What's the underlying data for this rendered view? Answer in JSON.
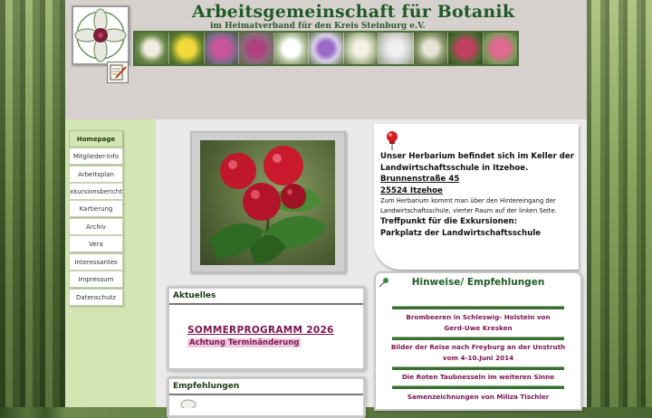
{
  "header": {
    "title": "Arbeitsgemeinschaft für Botanik",
    "subtitle": "im Heimatverband für den Kreis Steinburg e.V."
  },
  "icons": {
    "logo": "flower-emblem-icon",
    "edit": "notepad-pen-icon",
    "pin": "red-pushpin-icon",
    "pushpin": "green-pushpin-icon"
  },
  "colors": {
    "title_green": "#1f5a28",
    "link_maroon": "#7a1450",
    "sidebar_green": "#d4e5b4"
  },
  "nav": {
    "items": [
      {
        "label": "Homepage",
        "active": true
      },
      {
        "label": "Mitglieder-Info"
      },
      {
        "label": "Arbeitsplan"
      },
      {
        "label": "Exkursionsberichte"
      },
      {
        "label": "Kartierung"
      },
      {
        "label": "Archiv"
      },
      {
        "label": "Vera"
      },
      {
        "label": "Interessantes"
      },
      {
        "label": "Impressum"
      },
      {
        "label": "Datenschutz"
      }
    ]
  },
  "info": {
    "line1": "Unser Herbarium befindet sich im Keller der",
    "line2": "Landwirtschaftsschule in Itzehoe.",
    "street": "Brunnenstraße 45",
    "city": "25524 Itzehoe",
    "note1": "Zum Herbarium kommt man über den Hintereingang der",
    "note2": "Landwirtschaftsschule, vierter Raum auf der linken Seite.",
    "meet1": "Treffpunkt für die Exkursionen:",
    "meet2": "Parkplatz der Landwirtschaftsschule"
  },
  "aktuelles": {
    "heading": "Aktuelles",
    "title": "SOMMERPROGRAMM 2026",
    "subtitle": "Achtung Terminänderung"
  },
  "empfehlungen": {
    "heading": "Empfehlungen"
  },
  "hinweise": {
    "heading": "Hinweise/ Empfehlungen",
    "links": [
      {
        "l1": "Brombeeren in Schleswig- Holstein von",
        "l2": "Gerd-Uwe Kresken"
      },
      {
        "l1": "Bilder der Reise nach Freyburg an der Unstruth",
        "l2": "vom 4-10.Juni 2014"
      },
      {
        "l1": "Die Roten Taubnesseln im weiteren Sinne",
        "l2": ""
      },
      {
        "l1": "Samenzeichnungen von Miliza Tischler",
        "l2": ""
      }
    ]
  }
}
